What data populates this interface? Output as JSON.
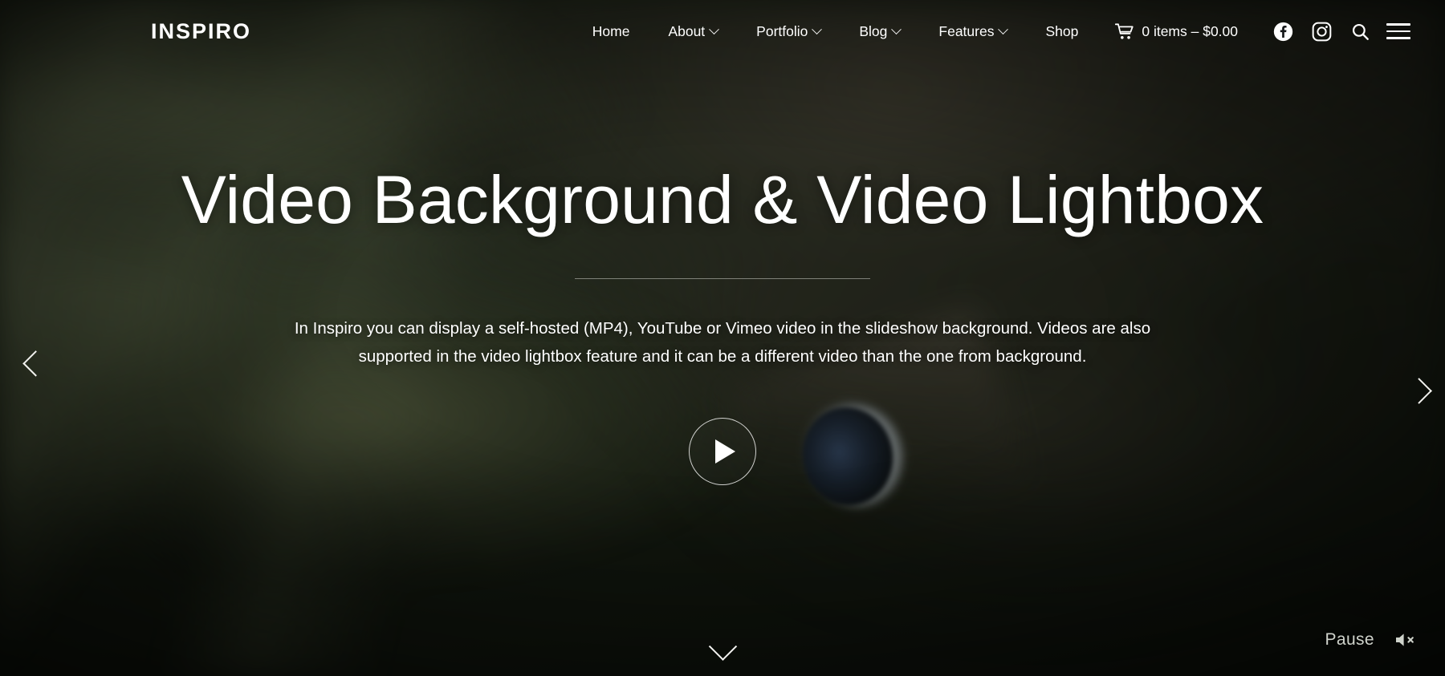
{
  "header": {
    "logo": "INSPIRO",
    "nav": [
      {
        "label": "Home",
        "has_dropdown": false
      },
      {
        "label": "About",
        "has_dropdown": true
      },
      {
        "label": "Portfolio",
        "has_dropdown": true
      },
      {
        "label": "Blog",
        "has_dropdown": true
      },
      {
        "label": "Features",
        "has_dropdown": true
      },
      {
        "label": "Shop",
        "has_dropdown": false
      }
    ],
    "cart": {
      "icon": "shopping-cart-icon",
      "label": "0 items – $0.00",
      "count": 0,
      "total": "$0.00"
    },
    "icons": [
      {
        "name": "facebook-icon"
      },
      {
        "name": "instagram-icon"
      },
      {
        "name": "search-icon"
      },
      {
        "name": "hamburger-menu-icon"
      }
    ]
  },
  "slide": {
    "title": "Video Background & Video Lightbox",
    "description": "In Inspiro you can display a self-hosted (MP4), YouTube or Vimeo video in the slideshow background. Videos are also supported in the video lightbox feature and it can be a different video than the one from background.",
    "play_icon": "play-icon"
  },
  "slider": {
    "prev_icon": "chevron-left-icon",
    "next_icon": "chevron-right-icon",
    "scroll_icon": "chevron-down-icon"
  },
  "media_controls": {
    "pause_label": "Pause",
    "mute_icon": "speaker-muted-icon"
  },
  "colors": {
    "text": "#ffffff",
    "muted_text": "#cfd3cb",
    "divider": "rgba(220,222,216,0.50)",
    "backdrop_dark": "#10130e",
    "backdrop_olive": "#3a4330"
  }
}
